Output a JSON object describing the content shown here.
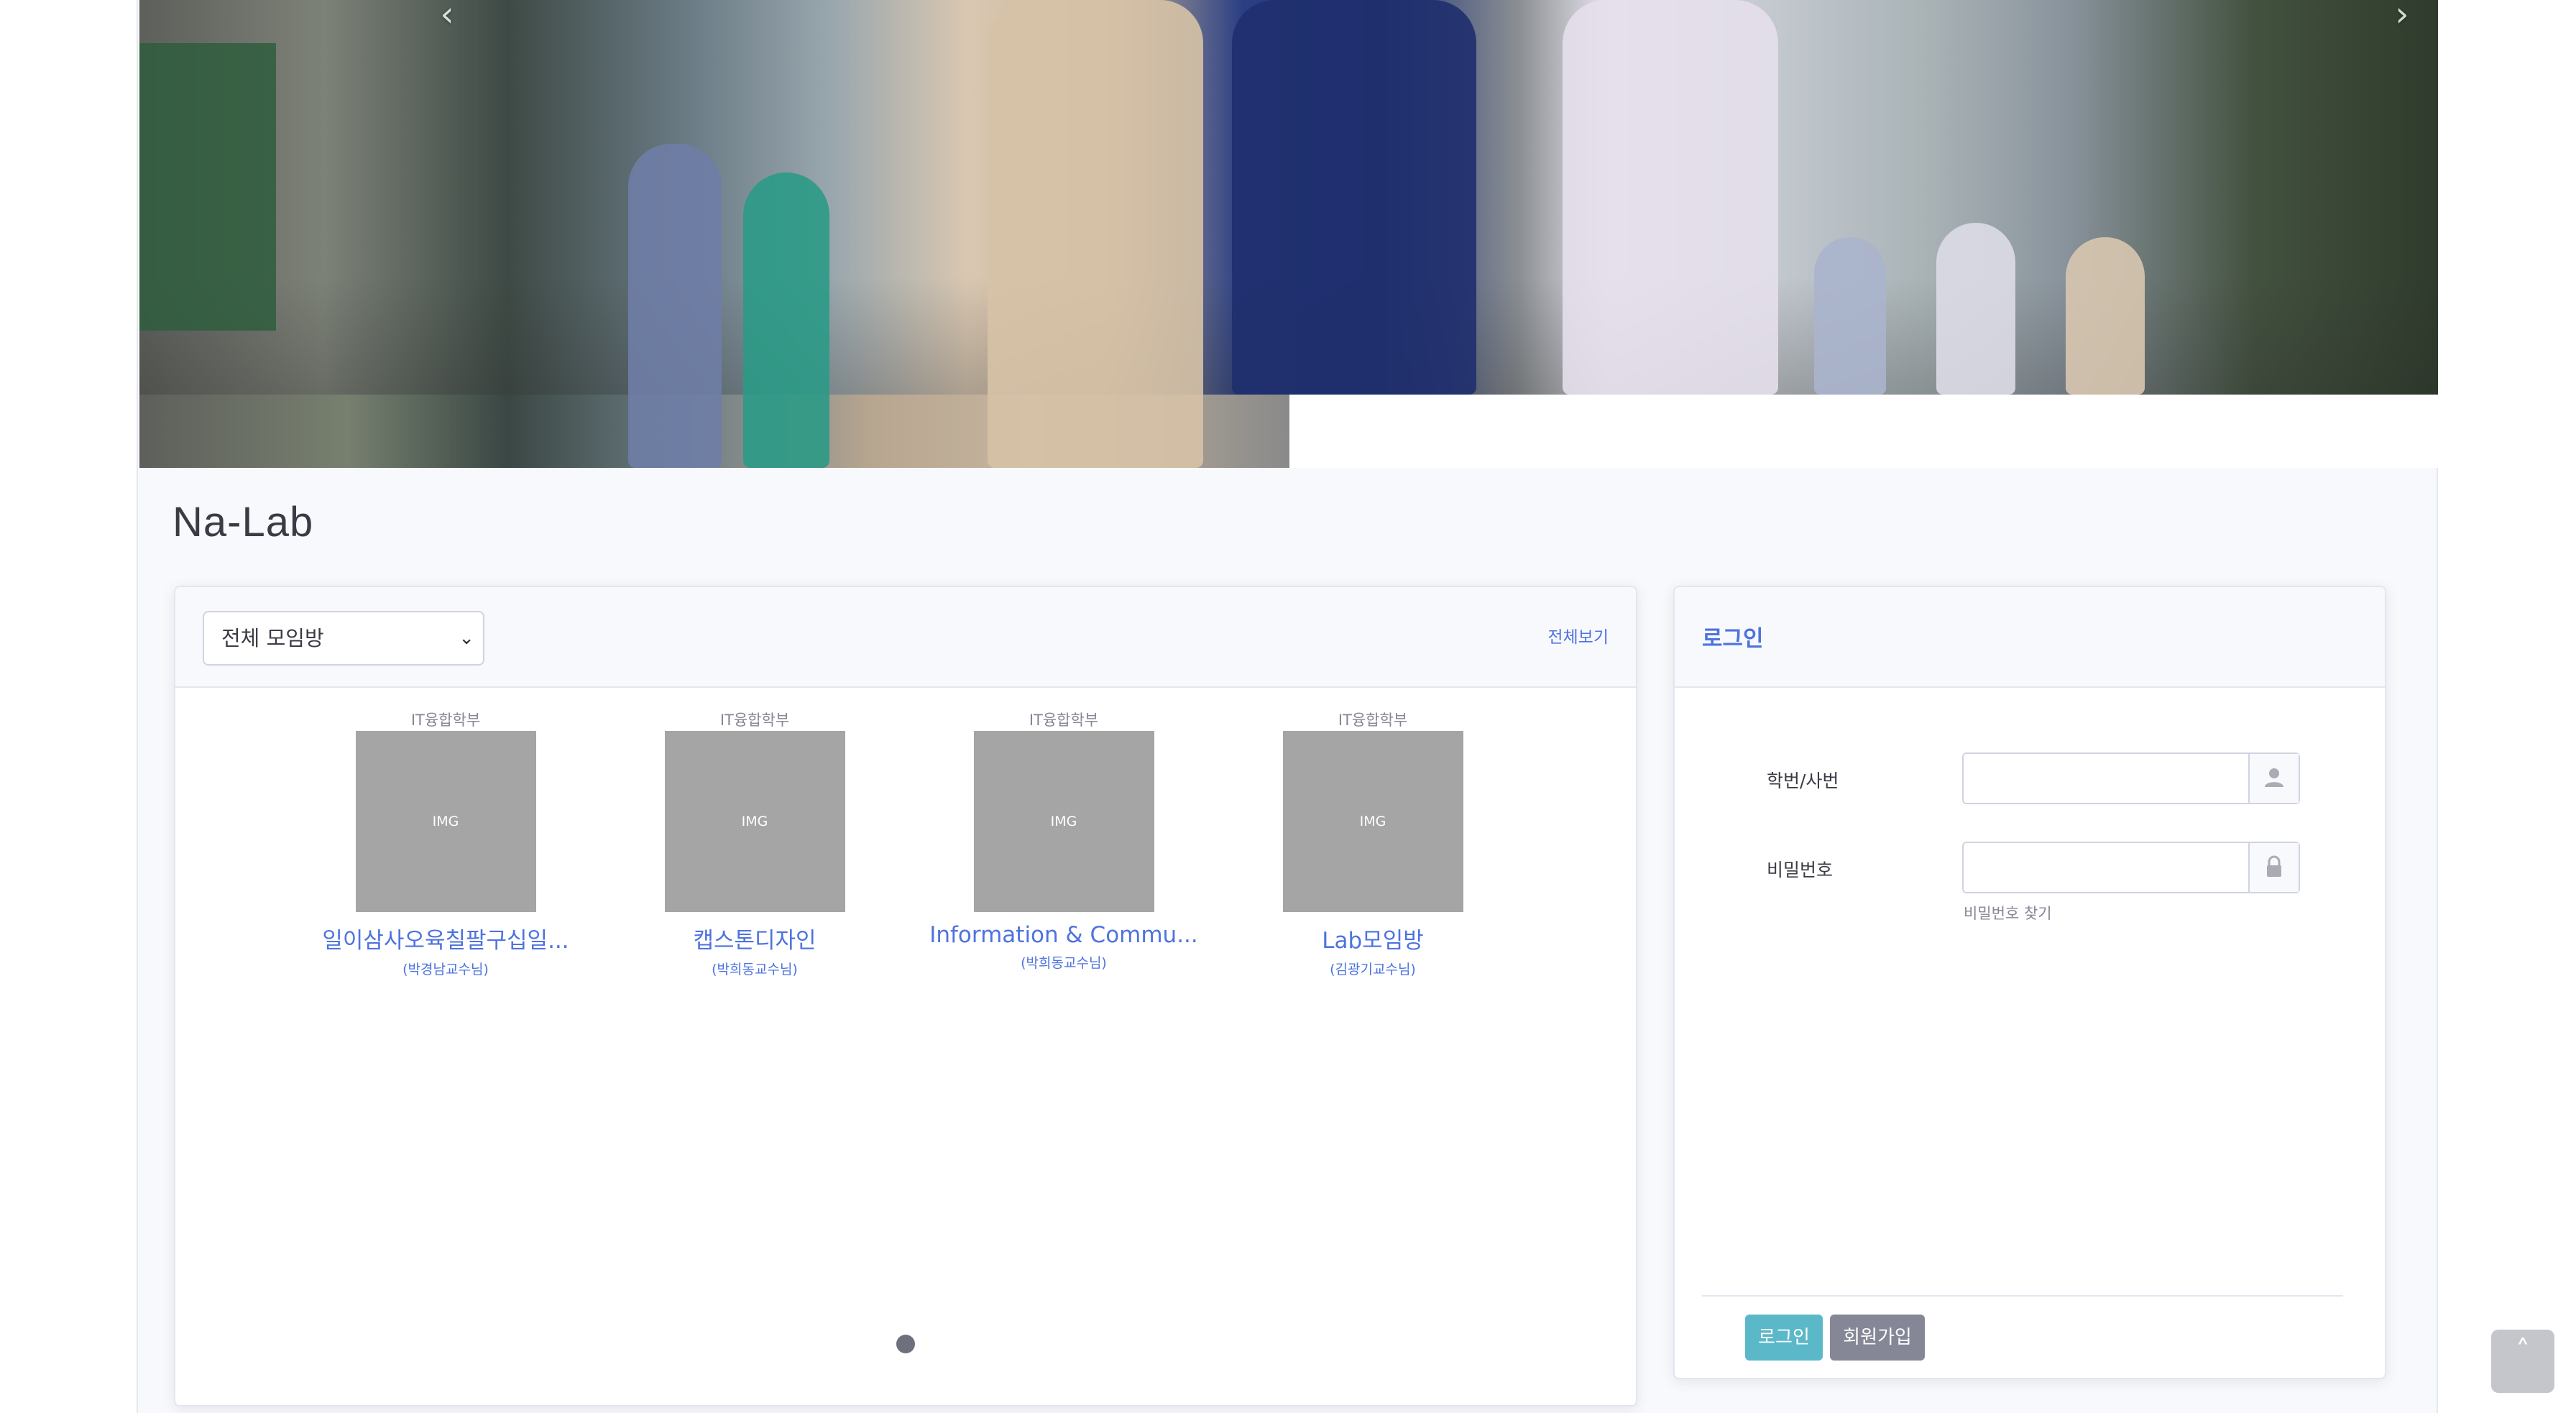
{
  "hero": {
    "prev_arrow": "‹",
    "next_arrow": "›",
    "image_icon": "photo-icon"
  },
  "site": {
    "title": "Na-Lab"
  },
  "rooms": {
    "filter_selected": "전체 모임방",
    "view_all_label": "전체보기",
    "items": [
      {
        "dept": "IT융합학부",
        "thumb": "IMG",
        "name": "일이삼사오육칠팔구십일...",
        "prof": "(박경남교수님)"
      },
      {
        "dept": "IT융합학부",
        "thumb": "IMG",
        "name": "캡스톤디자인",
        "prof": "(박희동교수님)"
      },
      {
        "dept": "IT융합학부",
        "thumb": "IMG",
        "name": "Information & Commu...",
        "prof": "(박희동교수님)"
      },
      {
        "dept": "IT융합학부",
        "thumb": "IMG",
        "name": "Lab모임방",
        "prof": "(김광기교수님)"
      }
    ],
    "active_page": 1
  },
  "login": {
    "title": "로그인",
    "id_label": "학번/사번",
    "id_value": "",
    "id_icon": "user-icon",
    "pw_label": "비밀번호",
    "pw_value": "",
    "pw_icon": "lock-icon",
    "find_pw_label": "비밀번호 찾기",
    "login_button": "로그인",
    "signup_button": "회원가입"
  },
  "scroll_top": {
    "icon": "chevron-up-icon",
    "glyph": "˄"
  },
  "colors": {
    "link": "#4e73df",
    "login_button": "#5bb8c9",
    "signup_button": "#858796",
    "thumb_placeholder": "#a5a5a5"
  }
}
